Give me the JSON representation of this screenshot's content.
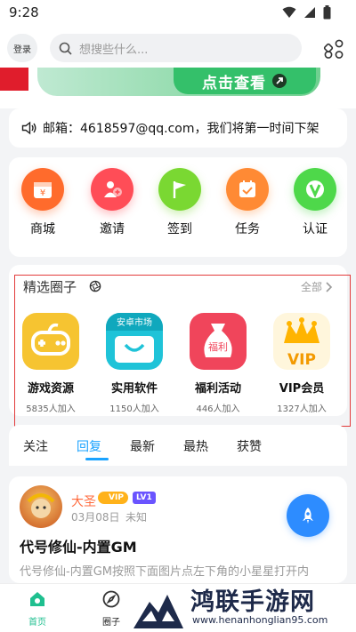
{
  "status_bar": {
    "time": "9:28"
  },
  "header": {
    "login_label": "登录",
    "search_placeholder": "想搜些什么..."
  },
  "banner": {
    "text": "点击查看"
  },
  "notice": {
    "text": "邮箱：4618597@qq.com，我们将第一时间下架"
  },
  "shortcuts": [
    {
      "label": "商城",
      "icon": "store-icon",
      "color": "#ff6b2c"
    },
    {
      "label": "邀请",
      "icon": "invite-icon",
      "color": "#ff4d57"
    },
    {
      "label": "签到",
      "icon": "flag-icon",
      "color": "#7ad832"
    },
    {
      "label": "任务",
      "icon": "task-icon",
      "color": "#ff8a34"
    },
    {
      "label": "认证",
      "icon": "verify-icon",
      "color": "#4ed84a"
    }
  ],
  "circles": {
    "title": "精选圈子",
    "all_label": "全部",
    "items": [
      {
        "name": "游戏资源",
        "count": "5835人加入",
        "icon": "gamepad-icon",
        "color": "#f6c431"
      },
      {
        "name": "实用软件",
        "count": "1150人加入",
        "icon": "market-bag-icon",
        "badge": "安卓市场",
        "color": "#1fc3d8"
      },
      {
        "name": "福利活动",
        "count": "446人加入",
        "icon": "gift-bag-icon",
        "badge": "福利",
        "color": "#f0455b"
      },
      {
        "name": "VIP会员",
        "count": "1327人加入",
        "icon": "vip-crown-icon",
        "badge": "VIP",
        "color": "#ffb400"
      }
    ]
  },
  "tabs": [
    {
      "label": "关注",
      "active": false
    },
    {
      "label": "回复",
      "active": true
    },
    {
      "label": "最新",
      "active": false
    },
    {
      "label": "最热",
      "active": false
    },
    {
      "label": "获赞",
      "active": false
    }
  ],
  "post": {
    "author": "大圣",
    "vip_badge": "VIP",
    "level_badge": "LV1",
    "date": "03月08日",
    "location": "未知",
    "title": "代号修仙-内置GM",
    "excerpt": "代号修仙-内置GM按照下面图片点左下角的小星星打开内"
  },
  "bottom_nav": [
    {
      "label": "首页",
      "icon": "home-icon",
      "active": true
    },
    {
      "label": "圈子",
      "icon": "compass-icon",
      "active": false
    }
  ],
  "watermark": {
    "title": "鸿联手游网",
    "url": "www.henanhonglian95.com"
  },
  "colors": {
    "accent": "#1aa3ff",
    "highlight_border": "#e23b3b",
    "home_active": "#1fbf8f"
  }
}
